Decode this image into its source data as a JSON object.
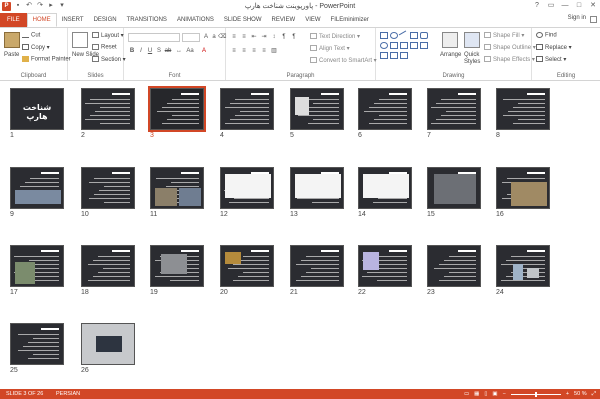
{
  "window": {
    "title": "پاورپوینت شناخت هارپ - PowerPoint",
    "controls": [
      "?",
      "▭",
      "—",
      "□",
      "✕"
    ]
  },
  "tabs": [
    "FILE",
    "HOME",
    "INSERT",
    "DESIGN",
    "TRANSITIONS",
    "ANIMATIONS",
    "SLIDE SHOW",
    "REVIEW",
    "VIEW",
    "FILEminimizer"
  ],
  "active_tab": "HOME",
  "signin": "Sign in",
  "ribbon": {
    "clipboard": {
      "paste": "Paste",
      "cut": "Cut",
      "copy": "Copy",
      "format_painter": "Format Painter",
      "label": "Clipboard"
    },
    "slides": {
      "new_slide": "New Slide",
      "layout": "Layout",
      "reset": "Reset",
      "section": "Section",
      "label": "Slides"
    },
    "font": {
      "label": "Font"
    },
    "paragraph": {
      "text_direction": "Text Direction",
      "align_text": "Align Text",
      "convert_smartart": "Convert to SmartArt",
      "label": "Paragraph"
    },
    "drawing": {
      "arrange": "Arrange",
      "quick_styles": "Quick Styles",
      "shape_fill": "Shape Fill",
      "shape_outline": "Shape Outline",
      "shape_effects": "Shape Effects",
      "label": "Drawing"
    },
    "editing": {
      "find": "Find",
      "replace": "Replace",
      "select": "Select",
      "label": "Editing"
    }
  },
  "slides": [
    {
      "num": "1",
      "title_text": "شناخت هارپ"
    },
    {
      "num": "2"
    },
    {
      "num": "3"
    },
    {
      "num": "4"
    },
    {
      "num": "5"
    },
    {
      "num": "6"
    },
    {
      "num": "7"
    },
    {
      "num": "8"
    },
    {
      "num": "9"
    },
    {
      "num": "10"
    },
    {
      "num": "11"
    },
    {
      "num": "12"
    },
    {
      "num": "13"
    },
    {
      "num": "14"
    },
    {
      "num": "15"
    },
    {
      "num": "16"
    },
    {
      "num": "17"
    },
    {
      "num": "18"
    },
    {
      "num": "19"
    },
    {
      "num": "20"
    },
    {
      "num": "21"
    },
    {
      "num": "22"
    },
    {
      "num": "23"
    },
    {
      "num": "24"
    },
    {
      "num": "25"
    },
    {
      "num": "26"
    }
  ],
  "selected_slide": 3,
  "status": {
    "slide_info": "SLIDE 3 OF 26",
    "language": "PERSIAN",
    "zoom": "50 %"
  },
  "colors": {
    "accent": "#d24726",
    "slide_bg": "#2b2c31"
  }
}
